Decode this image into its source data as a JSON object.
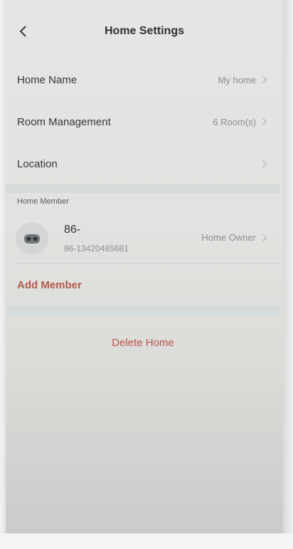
{
  "header": {
    "title": "Home Settings",
    "back_icon": "chevron-left-icon"
  },
  "settings": [
    {
      "label": "Home Name",
      "value": "My home"
    },
    {
      "label": "Room Management",
      "value": "6 Room(s)"
    },
    {
      "label": "Location",
      "value": ""
    }
  ],
  "members": {
    "section_label": "Home Member",
    "list": [
      {
        "name": "86-",
        "phone": "86-13420485681",
        "role": "Home Owner"
      }
    ],
    "add_label": "Add Member"
  },
  "delete_label": "Delete Home",
  "colors": {
    "accent": "#b35a4e",
    "secondary_text": "#8c8e8f",
    "primary_text": "#2f3133"
  }
}
